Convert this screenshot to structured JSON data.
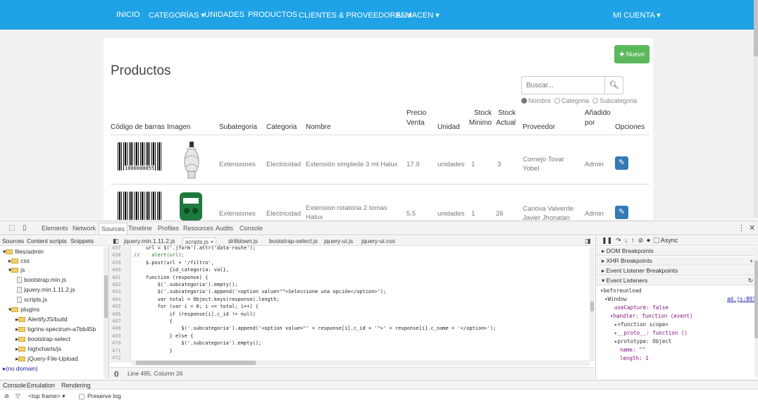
{
  "nav": {
    "items": [
      "INICIO",
      "CATEGORÍAS ▾",
      "UNIDADES",
      "PRODUCTOS",
      "CLIENTES & PROVEEDORES ▾",
      "ALMACEN ▾"
    ],
    "account": "MI CUENTA ▾"
  },
  "page": {
    "title": "Productos",
    "new_button": "Nuevo",
    "search_placeholder": "Buscar...",
    "filters": [
      "Nombre",
      "Categoria",
      "Subcategoria"
    ],
    "selected_filter": "Nombre"
  },
  "table": {
    "headers": [
      "Código de barras",
      "Imagen",
      "Subategoria",
      "Categoria",
      "Nombre",
      "Precio Venta",
      "Unidad",
      "Stock Minimo",
      "Stock Actual",
      "Proveedor",
      "Añadido por",
      "Opciones"
    ],
    "rows": [
      {
        "barcode": "1000000055",
        "subcategoria": "Extensiones",
        "categoria": "Electricidad",
        "nombre": "Extensión simplede 3 mt Halux",
        "precio": "17.9",
        "unidad": "unidades",
        "stock_min": "1",
        "stock_actual": "3",
        "proveedor": "Cornejo Tovar Yobel",
        "anadido": "Admin"
      },
      {
        "barcode": "",
        "subcategoria": "Extensiones",
        "categoria": "Electricidad",
        "nombre": "Extension rotatoria 2 tomas Halux",
        "precio": "5.5",
        "unidad": "unidades",
        "stock_min": "1",
        "stock_actual": "26",
        "proveedor": "Canova Valverde Javier Jhonatan",
        "anadido": "Admin"
      }
    ]
  },
  "devtools": {
    "tabs": [
      "Elements",
      "Network",
      "Sources",
      "Timeline",
      "Profiles",
      "Resources",
      "Audits",
      "Console"
    ],
    "active_tab": "Sources",
    "nav_tabs": [
      "Sources",
      "Content scripts",
      "Snippets"
    ],
    "tree": [
      "files/admin",
      "css",
      "js",
      "bootstrap.min.js",
      "jquery.min.1.11.2.js",
      "scripts.js",
      "plugins",
      "AlertifyJS/build",
      "bgrins-spectrum-a7bb45b",
      "bootstrap-select",
      "highcharts/js",
      "jQuery-File-Upload",
      "(no domain)"
    ],
    "editor_tabs": [
      "jquery.min.1.11.2.js",
      "scripts.js ×",
      "drilldown.js",
      "bootstrap-select.js",
      "jquery-ui.js",
      "jquery-ui.css"
    ],
    "line_numbers": [
      "457",
      "458",
      "459",
      "460",
      "461",
      "462",
      "463",
      "464",
      "465",
      "466",
      "467",
      "468",
      "469",
      "470",
      "471",
      "472"
    ],
    "code_lines": [
      "    url = $('.jform').attr('data-route');",
      "//    alert(url);",
      "    $.post(url + '/filtro',",
      "            {id_categoria: val},",
      "    function (response) {",
      "        $('.subcategoria').empty();",
      "        $('.subcategoria').append('<option value=\"\">Seleccione una opción</option>');",
      "        var total = Object.keys(response).length;",
      "        for (var i = 0; i <= total; i++) {",
      "            if (response[i].c_id != null)",
      "            {",
      "                $('.subcategoria').append('<option value=\"' + response[i].c_id + '\">' + response[i].c_name + '</option>');",
      "            } else {",
      "                $('.subcategoria').empty();",
      "            }",
      ""
    ],
    "status": "Line 495, Column 26",
    "pause_controls": "Async",
    "sections": [
      "DOM Breakpoints",
      "XHR Breakpoints",
      "Event Listener Breakpoints",
      "Event Listeners"
    ],
    "listeners": {
      "event": "beforeunload",
      "target": "Window",
      "link": "ad.js:893",
      "lines": [
        "useCapture: false",
        "handler: function (event)",
        "<function scope>",
        "__proto__: function ()",
        "prototype: Object",
        "name: \"\"",
        "length: 1"
      ]
    },
    "drawer_tabs": [
      "Console",
      "Emulation",
      "Rendering"
    ],
    "console": {
      "frame": "<top frame>",
      "preserve": "Preserve log"
    }
  }
}
